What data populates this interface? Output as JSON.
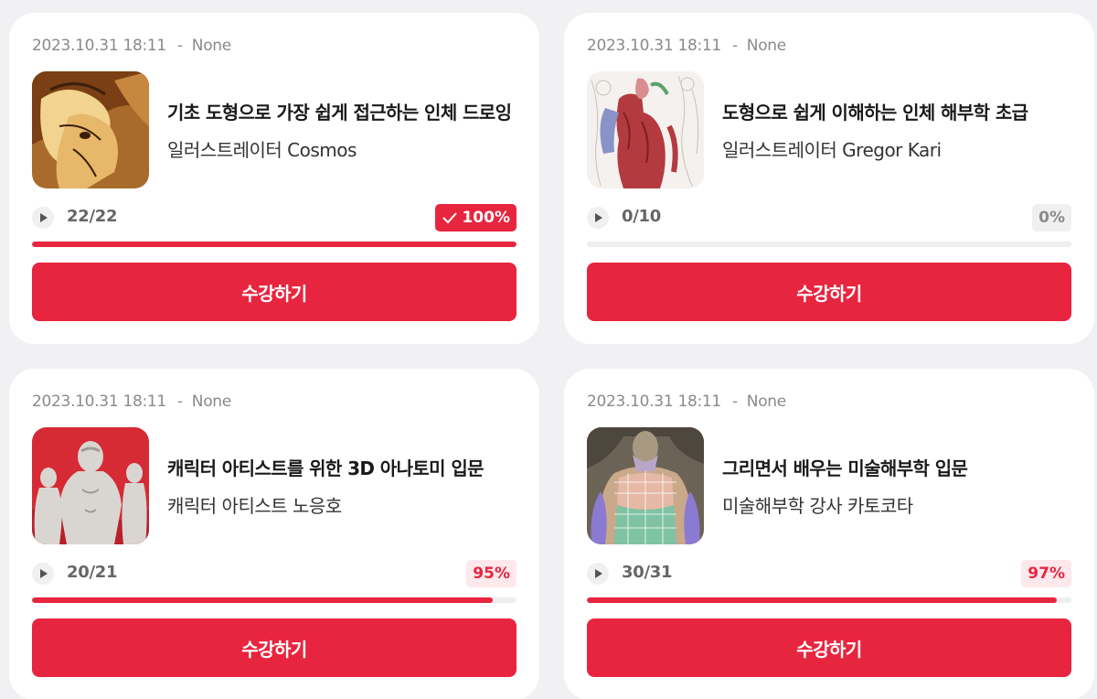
{
  "courses": [
    {
      "date": "2023.10.31 18:11",
      "status": "None",
      "title": "기초 도형으로 가장 쉽게 접근하는 인체 드로잉",
      "instructor": "일러스트레이터 Cosmos",
      "lessons": "22/22",
      "progress_label": "100%",
      "progress": 1.0,
      "button_label": "수강하기"
    },
    {
      "date": "2023.10.31 18:11",
      "status": "None",
      "title": "도형으로 쉽게 이해하는 인체 해부학 초급",
      "instructor": "일러스트레이터 Gregor Kari",
      "lessons": "0/10",
      "progress_label": "0%",
      "progress": 0.0,
      "button_label": "수강하기"
    },
    {
      "date": "2023.10.31 18:11",
      "status": "None",
      "title": "캐릭터 아티스트를 위한 3D 아나토미 입문",
      "instructor": "캐릭터 아티스트 노응호",
      "lessons": "20/21",
      "progress_label": "95%",
      "progress": 0.95,
      "button_label": "수강하기"
    },
    {
      "date": "2023.10.31 18:11",
      "status": "None",
      "title": "그리면서 배우는 미술해부학 입문",
      "instructor": "미술해부학 강사 카토코타",
      "lessons": "30/31",
      "progress_label": "97%",
      "progress": 0.97,
      "button_label": "수강하기"
    }
  ],
  "colors": {
    "accent": "#e8253f",
    "accent_light": "#fde8eb",
    "track": "#eeeeee",
    "background": "#f1f1f3"
  },
  "icons": {
    "play": "play-icon",
    "check": "check-icon"
  }
}
